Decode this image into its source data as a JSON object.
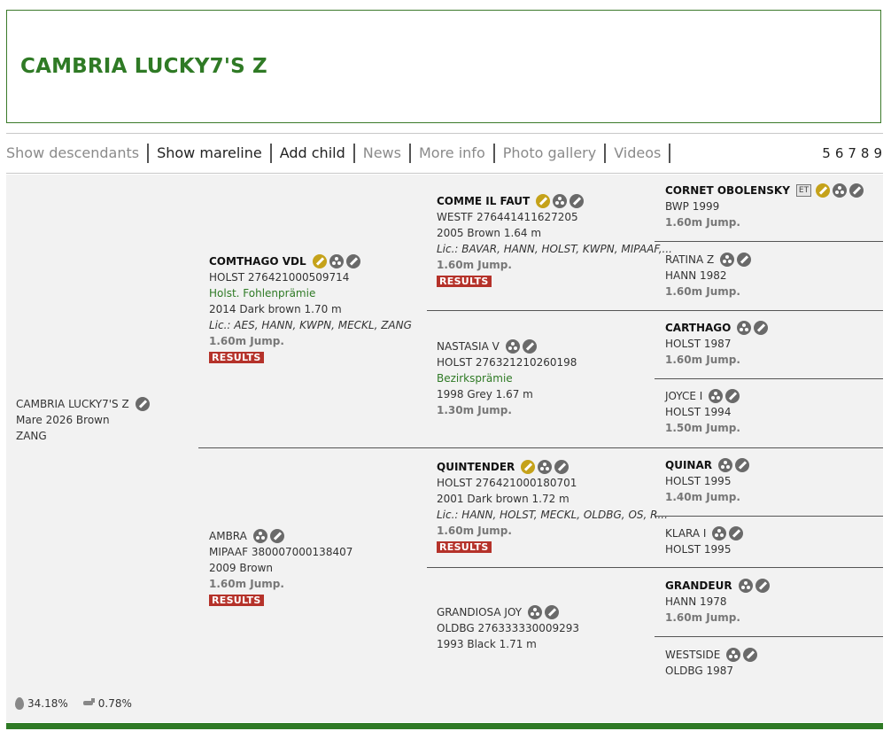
{
  "header": {
    "title": "CAMBRIA LUCKY7'S Z"
  },
  "nav": {
    "items": [
      {
        "label": "Show descendants",
        "muted": true
      },
      {
        "label": "Show mareline",
        "muted": false
      },
      {
        "label": "Add child",
        "muted": false
      },
      {
        "label": "News",
        "muted": true
      },
      {
        "label": "More info",
        "muted": true
      },
      {
        "label": "Photo gallery",
        "muted": true
      },
      {
        "label": "Videos",
        "muted": true
      }
    ],
    "generations": [
      "5",
      "6",
      "7",
      "8",
      "9"
    ]
  },
  "subject": {
    "name": "CAMBRIA LUCKY7'S Z",
    "line1": "Mare 2026 Brown",
    "line2": "ZANG"
  },
  "sire": {
    "name": "COMTHAGO VDL",
    "reg": "HOLST 276421000509714",
    "award": "Holst. Fohlenprämie",
    "info": "2014 Dark brown 1.70 m",
    "lic": "Lic.: AES, HANN, KWPN, MECKL, ZANG",
    "jump": "1.60m Jump.",
    "results": "RESULTS"
  },
  "dam": {
    "name": "AMBRA",
    "reg": "MIPAAF 380007000138407",
    "info": "2009 Brown",
    "jump": "1.60m Jump.",
    "results": "RESULTS"
  },
  "ss": {
    "name": "COMME IL FAUT",
    "reg": "WESTF 276441411627205",
    "info": "2005 Brown 1.64 m",
    "lic": "Lic.: BAVAR, HANN, HOLST, KWPN, MIPAAF,...",
    "jump": "1.60m Jump.",
    "results": "RESULTS"
  },
  "sd": {
    "name": "NASTASIA V",
    "reg": "HOLST 276321210260198",
    "award": "Bezirksprämie",
    "info": "1998 Grey 1.67 m",
    "jump": "1.30m Jump."
  },
  "ds": {
    "name": "QUINTENDER",
    "reg": "HOLST 276421000180701",
    "info": "2001 Dark brown 1.72 m",
    "lic": "Lic.: HANN, HOLST, MECKL, OLDBG, OS, R...",
    "jump": "1.60m Jump.",
    "results": "RESULTS"
  },
  "dd": {
    "name": "GRANDIOSA JOY",
    "reg": "OLDBG 276333330009293",
    "info": "1993 Black 1.71 m"
  },
  "g4": [
    {
      "name": "CORNET OBOLENSKY",
      "badge": "ET",
      "reg": "BWP 1999",
      "jump": "1.60m Jump."
    },
    {
      "name": "RATINA Z",
      "reg": "HANN 1982",
      "jump": "1.60m Jump."
    },
    {
      "name": "CARTHAGO",
      "reg": "HOLST 1987",
      "jump": "1.60m Jump."
    },
    {
      "name": "JOYCE I",
      "reg": "HOLST 1994",
      "jump": "1.50m Jump."
    },
    {
      "name": "QUINAR",
      "reg": "HOLST 1995",
      "jump": "1.40m Jump."
    },
    {
      "name": "KLARA I",
      "reg": "HOLST 1995"
    },
    {
      "name": "GRANDEUR",
      "reg": "HANN 1978",
      "jump": "1.60m Jump."
    },
    {
      "name": "WESTSIDE",
      "reg": "OLDBG 1987"
    }
  ],
  "stats": {
    "inbreeding": "34.18%",
    "blood": "0.78%"
  }
}
